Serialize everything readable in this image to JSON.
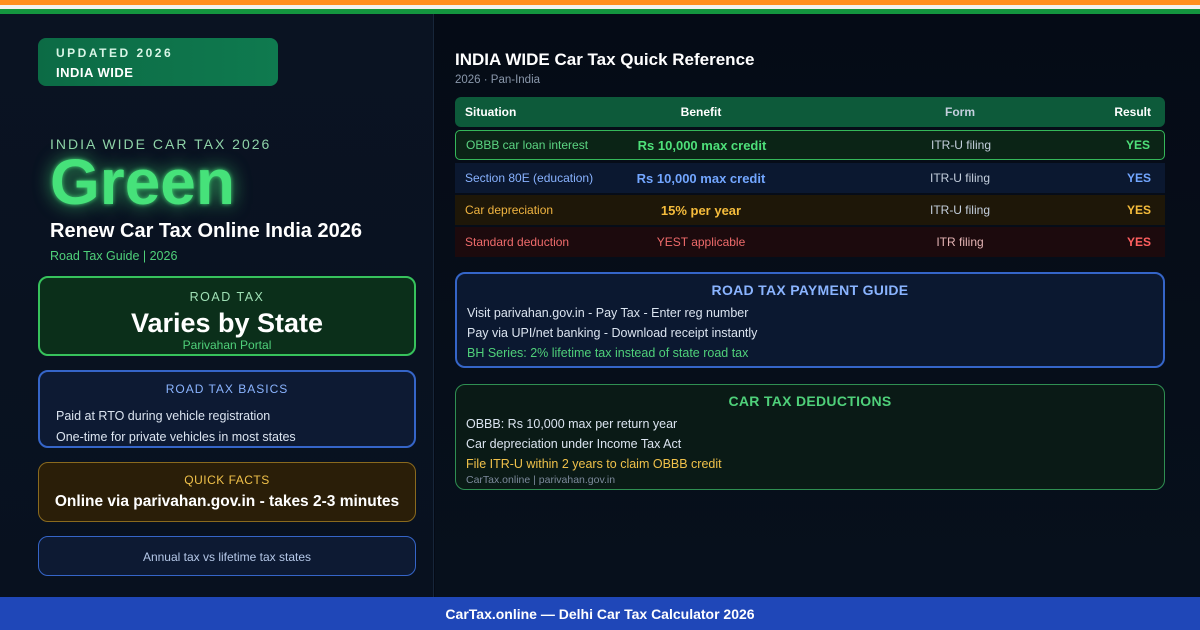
{
  "badge": {
    "line1": "UPDATED 2026",
    "line2": "INDIA WIDE"
  },
  "hero": {
    "overline": "INDIA WIDE CAR TAX 2026",
    "word": "Green",
    "title": "Renew Car Tax Online India 2026",
    "subtitle": "Road Tax Guide | 2026"
  },
  "road_tax_card": {
    "label": "ROAD TAX",
    "value": "Varies by State",
    "sub": "Parivahan Portal"
  },
  "basics_card": {
    "label": "ROAD TAX BASICS",
    "lines": [
      "Paid at RTO during vehicle registration",
      "One-time for private vehicles in most states"
    ]
  },
  "facts_card": {
    "label": "QUICK FACTS",
    "value": "Online via parivahan.gov.in - takes 2-3 minutes"
  },
  "annual_card": {
    "value": "Annual tax vs lifetime tax states"
  },
  "reference": {
    "title": "INDIA WIDE Car Tax Quick Reference",
    "subtitle": "2026 · Pan-India",
    "headers": {
      "situation": "Situation",
      "benefit": "Benefit",
      "form": "Form",
      "result": "Result"
    },
    "rows": [
      {
        "situation": "OBBB car loan interest",
        "benefit": "Rs 10,000 max credit",
        "form": "ITR-U filing",
        "result": "YES"
      },
      {
        "situation": "Section 80E (education)",
        "benefit": "Rs 10,000 max credit",
        "form": "ITR-U filing",
        "result": "YES"
      },
      {
        "situation": "Car depreciation",
        "benefit": "15% per year",
        "form": "ITR-U filing",
        "result": "YES"
      },
      {
        "situation": "Standard deduction",
        "benefit": "YEST applicable",
        "form": "ITR filing",
        "result": "YES"
      }
    ]
  },
  "payment_guide": {
    "title": "ROAD TAX PAYMENT GUIDE",
    "lines": [
      "Visit parivahan.gov.in - Pay Tax - Enter reg number",
      "Pay via UPI/net banking - Download receipt instantly",
      "BH Series: 2% lifetime tax instead of state road tax"
    ]
  },
  "deductions": {
    "title": "CAR TAX DEDUCTIONS",
    "lines": [
      "OBBB: Rs 10,000 max per return year",
      "Car depreciation under Income Tax Act",
      "File ITR-U within 2 years to claim OBBB credit"
    ],
    "source": "CarTax.online | parivahan.gov.in"
  },
  "footer": {
    "text": "CarTax.online — Delhi Car Tax Calculator 2026"
  },
  "colors": {
    "saffron": "#ff8f1f",
    "india_green": "#14953f",
    "accent_green": "#46e27a",
    "accent_blue": "#72a6ff",
    "accent_gold": "#f5bc3c",
    "accent_red": "#ff6060",
    "footer_blue": "#1f47b8"
  }
}
